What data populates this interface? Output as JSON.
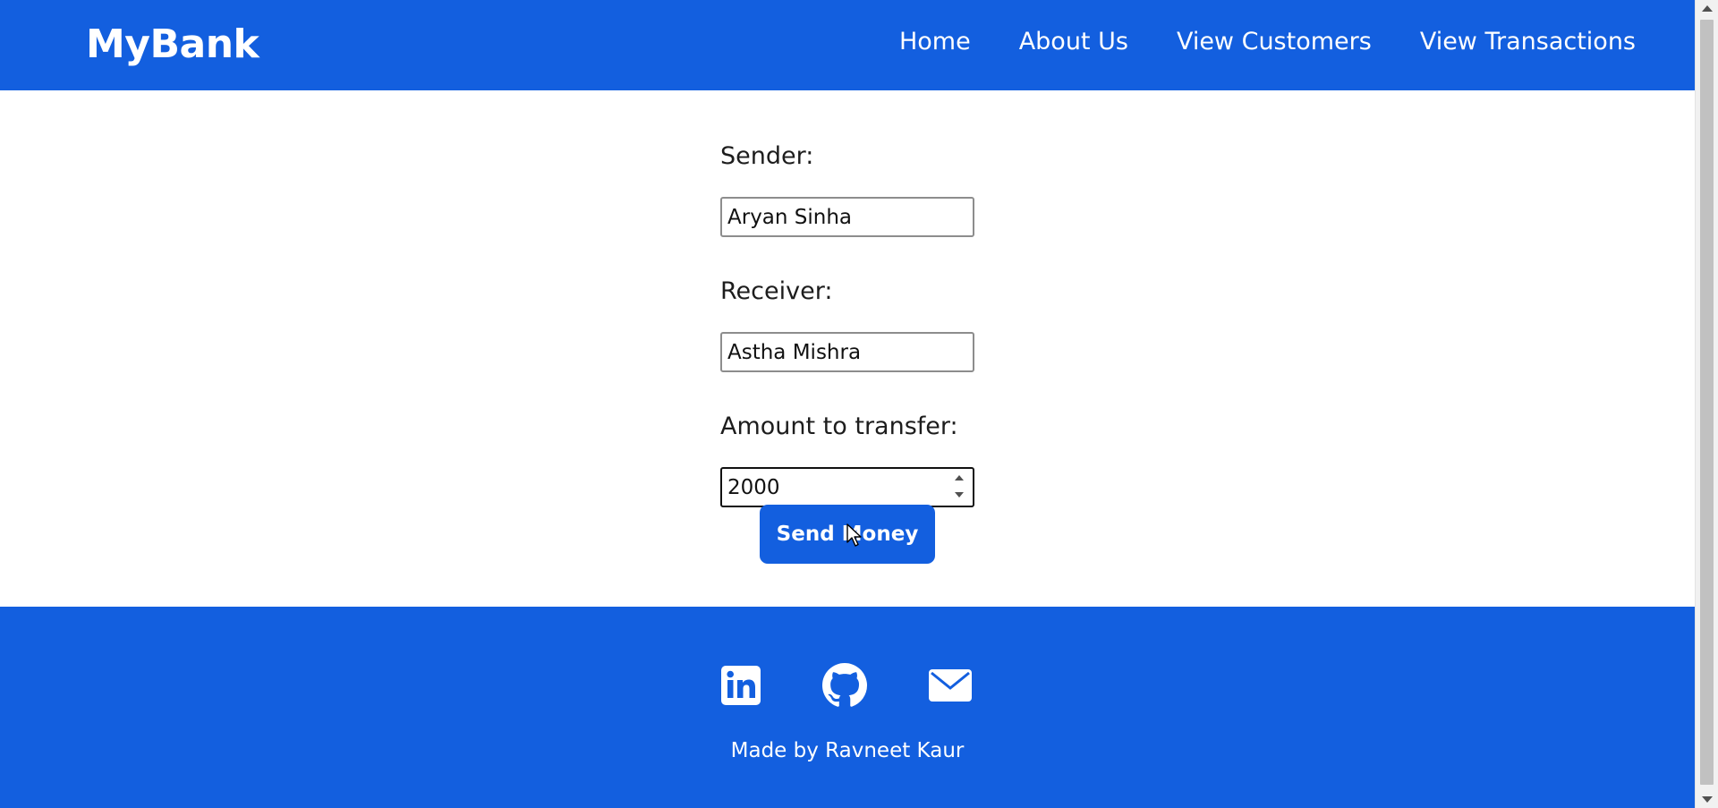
{
  "header": {
    "brand": "MyBank",
    "nav": [
      {
        "label": "Home"
      },
      {
        "label": "About Us"
      },
      {
        "label": "View Customers"
      },
      {
        "label": "View Transactions"
      }
    ]
  },
  "form": {
    "sender_label": "Sender:",
    "sender_value": "Aryan Sinha",
    "receiver_label": "Receiver:",
    "receiver_value": "Astha Mishra",
    "amount_label": "Amount to transfer:",
    "amount_value": "2000",
    "submit_label": "Send Money"
  },
  "footer": {
    "social": [
      {
        "icon": "linkedin-icon"
      },
      {
        "icon": "github-icon"
      },
      {
        "icon": "email-icon"
      }
    ],
    "credit": "Made by Ravneet Kaur"
  },
  "colors": {
    "brand_blue": "#135fdf",
    "text_dark": "#1d1d1d",
    "white": "#ffffff"
  }
}
